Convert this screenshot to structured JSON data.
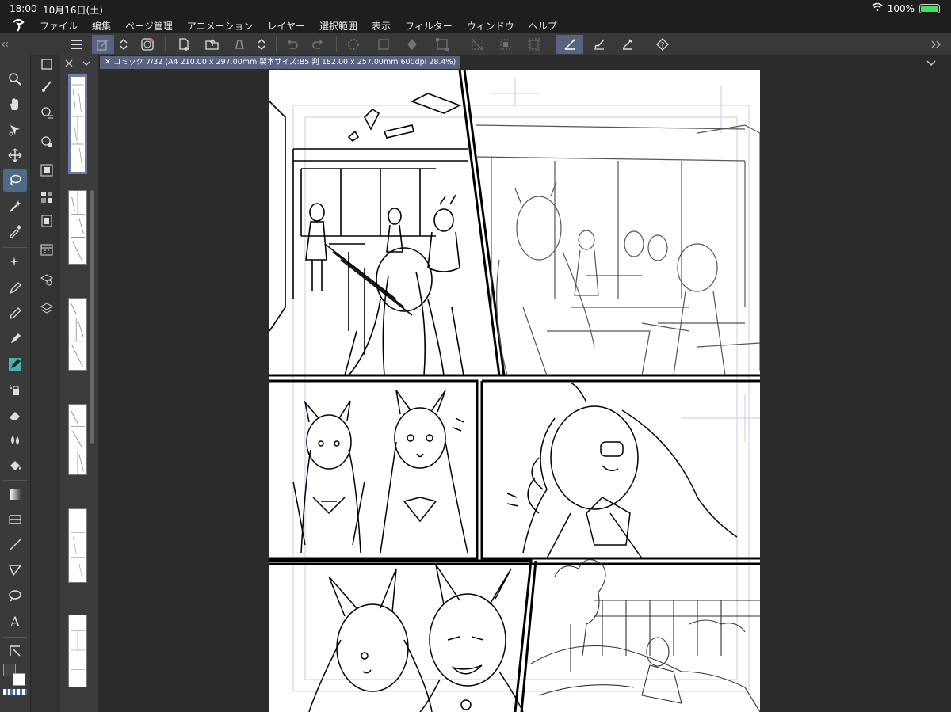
{
  "status": {
    "time": "18:00",
    "date": "10月16日(土)",
    "battery": "100%",
    "battery_level": 1.0
  },
  "menu": [
    "ファイル",
    "編集",
    "ページ管理",
    "アニメーション",
    "レイヤー",
    "選択範囲",
    "表示",
    "フィルター",
    "ウィンドウ",
    "ヘルプ"
  ],
  "tab": {
    "title": "コミック 7/32 (A4 210.00 x 297.00mm 製本サイズ:B5 判 182.00 x 257.00mm 600dpi 28.4%)"
  },
  "colors": {
    "accent": "#5a6281",
    "tool_active": "#4f6a86",
    "pen_tool": "#4ab3a8"
  },
  "toolbar_icons": [
    "menu-icon",
    "layer-property-icon",
    "toggle-icon",
    "record-icon",
    "new-page-icon",
    "open-icon",
    "save-icon",
    "undo-icon",
    "redo-icon",
    "loading-icon",
    "clear-icon",
    "fill-icon",
    "transform-icon",
    "deselect-icon",
    "invert-icon",
    "select-all-icon",
    "pen-stabilizer-icon",
    "brush-icon",
    "ruler-icon",
    "help-icon"
  ],
  "tool_icons": [
    "zoom-icon",
    "hand-icon",
    "rotate-icon",
    "move-icon",
    "lasso-icon",
    "magic-wand-icon",
    "eyedropper-icon",
    "sparkle-icon",
    "pen-icon",
    "pencil-icon",
    "marker-icon",
    "brush-icon",
    "airbrush-icon",
    "eraser-icon",
    "blend-icon",
    "fill-icon",
    "gradient-icon",
    "frame-icon",
    "line-icon",
    "shape-icon",
    "speech-bubble-icon",
    "text-icon",
    "correct-line-icon"
  ]
}
